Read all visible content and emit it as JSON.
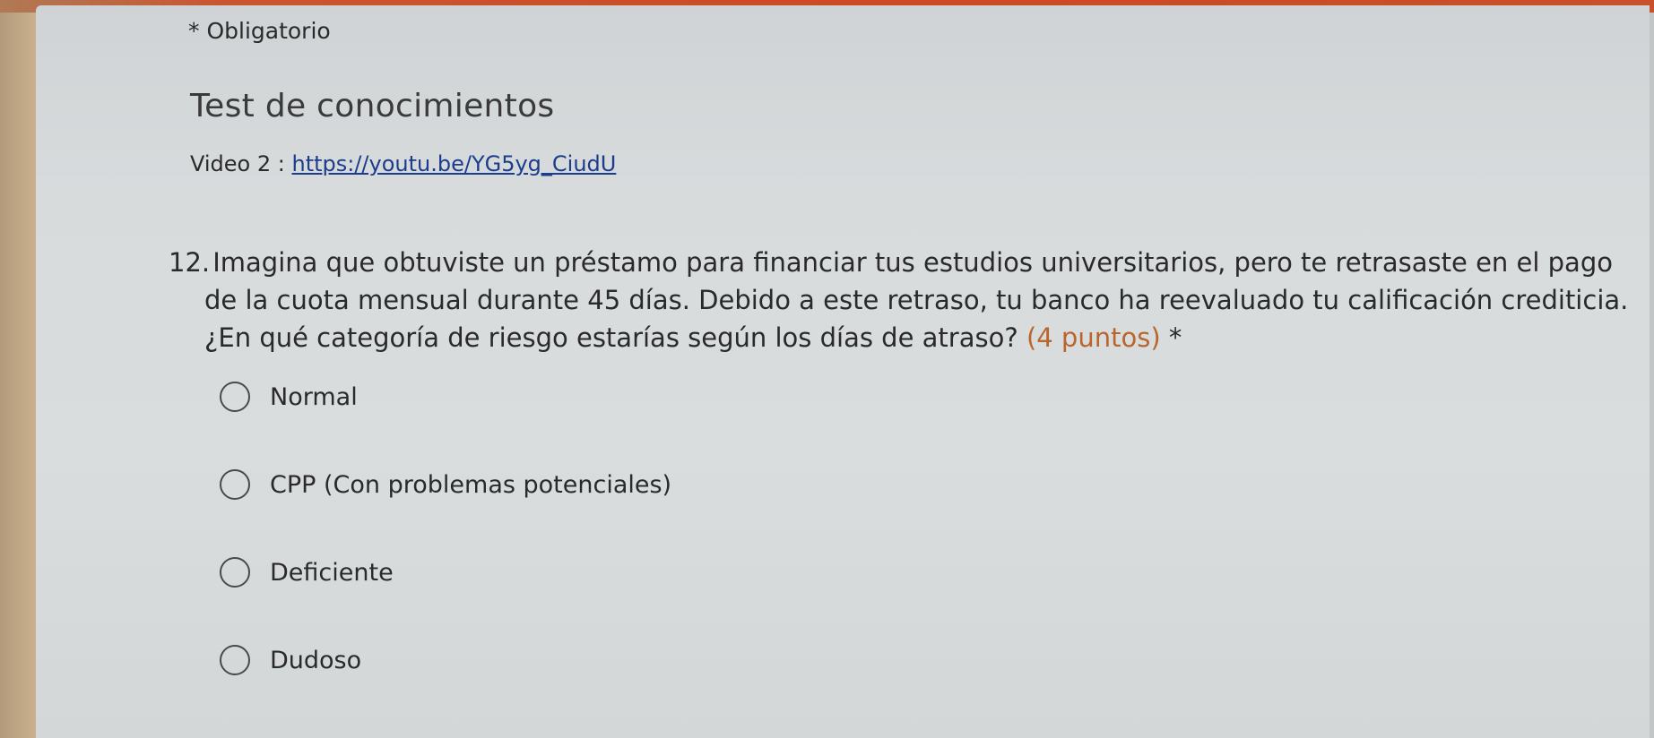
{
  "form": {
    "required_note": "* Obligatorio",
    "title": "Test de conocimientos",
    "video_label": "Video 2 : ",
    "video_link": "https://youtu.be/YG5yg_CiudU"
  },
  "question": {
    "number": "12.",
    "line1": "Imagina que obtuviste un préstamo para financiar tus estudios universitarios, pero te retrasaste en el pago",
    "line2": "de la cuota mensual durante 45 días. Debido a este retraso, tu banco ha reevaluado tu calificación crediticia.",
    "line3": "¿En qué categoría de riesgo estarías según los días de atraso?",
    "points": "(4 puntos)",
    "required_marker": "*",
    "options": [
      {
        "label": "Normal",
        "selected": false
      },
      {
        "label": "CPP (Con problemas potenciales)",
        "selected": false
      },
      {
        "label": "Deficiente",
        "selected": false
      },
      {
        "label": "Dudoso",
        "selected": false
      }
    ]
  },
  "colors": {
    "top_bar": "#cc4a25",
    "points_text": "#b9652d",
    "link": "#1d3d8c",
    "background": "#d7dbdc"
  }
}
